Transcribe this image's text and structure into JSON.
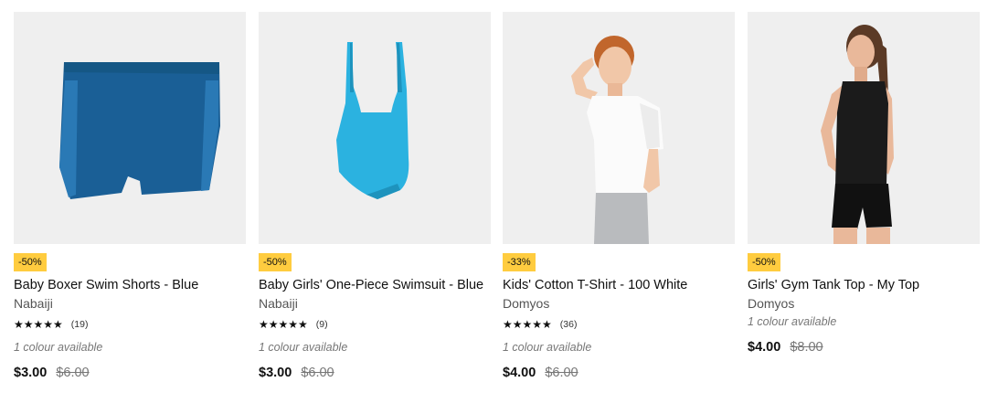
{
  "products": [
    {
      "badge": "-50%",
      "title": "Baby Boxer Swim Shorts - Blue",
      "brand": "Nabaiji",
      "stars": "★★★★★",
      "rating_count": "(19)",
      "colours": "1 colour available",
      "price_now": "$3.00",
      "price_was": "$6.00",
      "image_icon": "swim-shorts-icon",
      "image_color": "#1a5f96"
    },
    {
      "badge": "-50%",
      "title": "Baby Girls' One-Piece Swimsuit - Blue",
      "brand": "Nabaiji",
      "stars": "★★★★★",
      "rating_count": "(9)",
      "colours": "1 colour available",
      "price_now": "$3.00",
      "price_was": "$6.00",
      "image_icon": "swimsuit-icon",
      "image_color": "#2bb2e0"
    },
    {
      "badge": "-33%",
      "title": "Kids' Cotton T-Shirt - 100 White",
      "brand": "Domyos",
      "stars": "★★★★★",
      "rating_count": "(36)",
      "colours": "1 colour available",
      "price_now": "$4.00",
      "price_was": "$6.00",
      "image_icon": "child-tshirt-photo-icon",
      "image_color": "#ffffff"
    },
    {
      "badge": "-50%",
      "title": "Girls' Gym Tank Top - My Top",
      "brand": "Domyos",
      "colours": "1 colour available",
      "price_now": "$4.00",
      "price_was": "$8.00",
      "image_icon": "girl-tank-top-photo-icon",
      "image_color": "#1b1b1b"
    }
  ],
  "colors": {
    "badge_bg": "#ffcc3f",
    "image_bg": "#efefef",
    "text": "#101010",
    "muted": "#777777"
  }
}
